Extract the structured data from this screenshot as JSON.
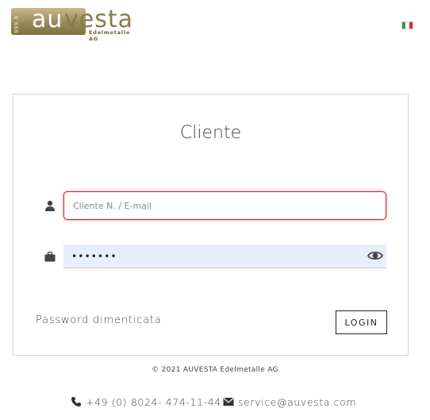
{
  "brand": {
    "logo_au": "au",
    "logo_vesta": "vesta",
    "logo_badge": "999,9",
    "logo_subtitle": "Edelmetalle AG"
  },
  "language": {
    "current_flag": "italian-flag-icon"
  },
  "login": {
    "title": "Cliente",
    "username_placeholder": "Cliente N. / E-mail",
    "username_value": "",
    "password_value": "•••••••",
    "forgot_label": "Password dimenticata",
    "login_label": "LOGIN"
  },
  "footer": {
    "copyright": "© 2021 AUVESTA Edelmetalle AG",
    "phone": "+49 (0) 8024- 474-11-44",
    "email": "service@auvesta.com"
  },
  "colors": {
    "gold": "#9b8a58",
    "error_border": "#d42020",
    "password_bg": "#e8effc"
  }
}
